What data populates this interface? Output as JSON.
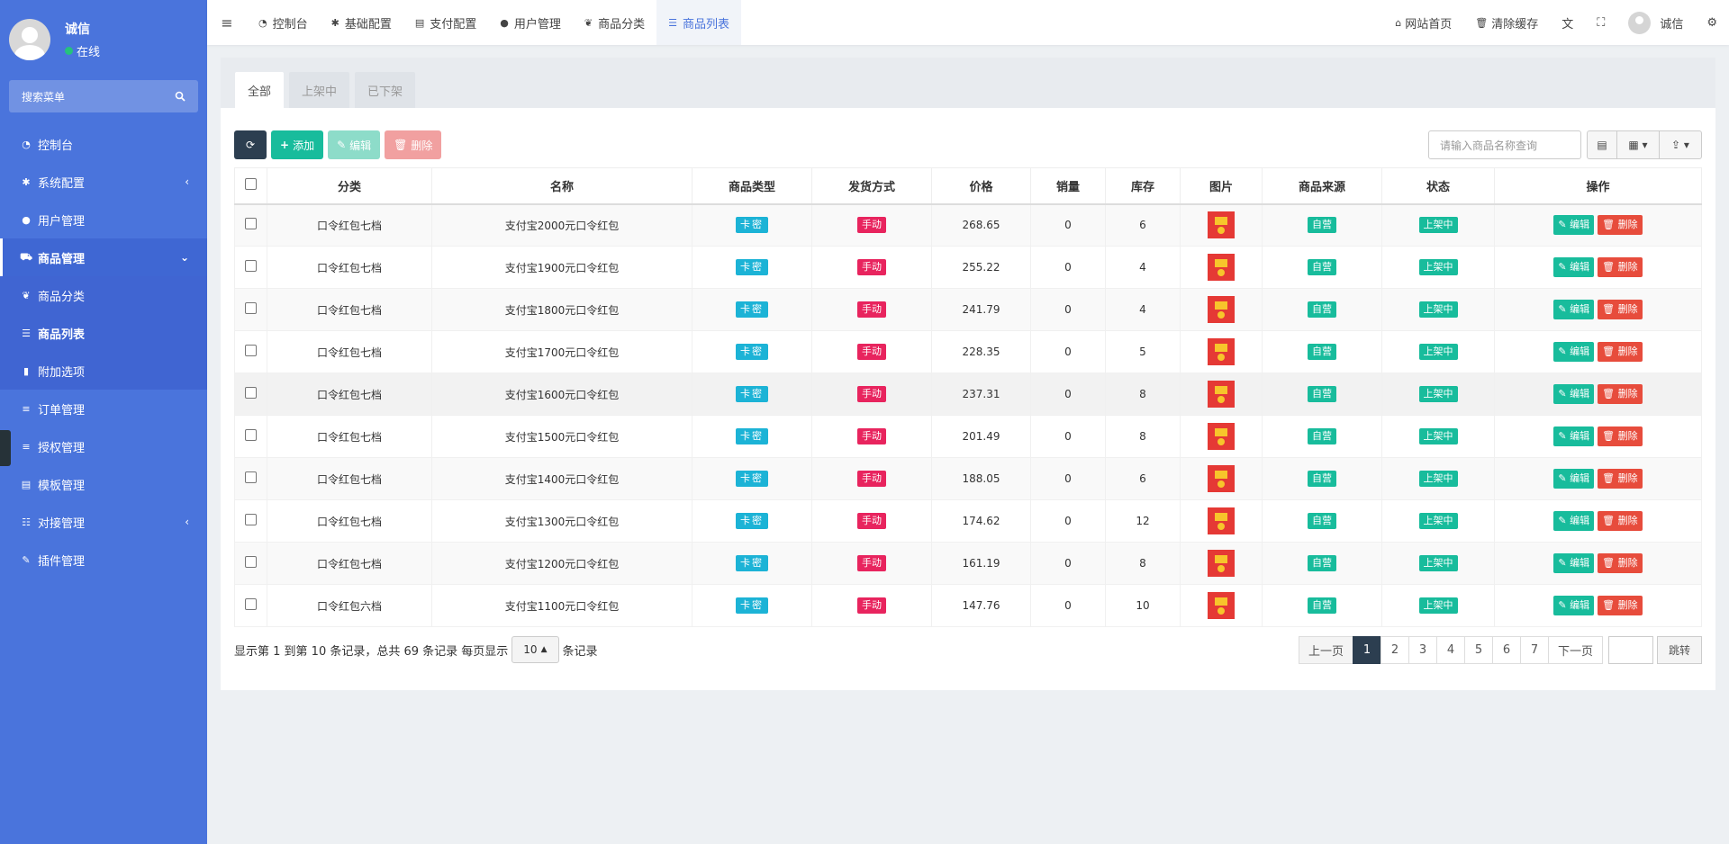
{
  "user": {
    "name": "诚信",
    "status": "在线"
  },
  "sidebar": {
    "search_placeholder": "搜索菜单",
    "items": [
      {
        "label": "控制台",
        "icon": "dashboard-icon"
      },
      {
        "label": "系统配置",
        "icon": "gear-icon"
      },
      {
        "label": "用户管理",
        "icon": "user-icon"
      },
      {
        "label": "商品管理",
        "icon": "cart-icon"
      },
      {
        "label": "商品分类",
        "icon": "leaf-icon"
      },
      {
        "label": "商品列表",
        "icon": "list-icon"
      },
      {
        "label": "附加选项",
        "icon": "bookmark-icon"
      },
      {
        "label": "订单管理",
        "icon": "bars-icon"
      },
      {
        "label": "授权管理",
        "icon": "bars-icon"
      },
      {
        "label": "模板管理",
        "icon": "table-icon"
      },
      {
        "label": "对接管理",
        "icon": "sliders-icon"
      },
      {
        "label": "插件管理",
        "icon": "plug-icon"
      }
    ]
  },
  "navbar": {
    "tabs": [
      "控制台",
      "基础配置",
      "支付配置",
      "用户管理",
      "商品分类",
      "商品列表"
    ],
    "home": "网站首页",
    "clear_cache": "清除缓存",
    "user": "诚信"
  },
  "tabs": [
    "全部",
    "上架中",
    "已下架"
  ],
  "toolbar": {
    "add": "添加",
    "edit": "编辑",
    "delete": "删除",
    "search_placeholder": "请输入商品名称查询"
  },
  "columns": [
    "分类",
    "名称",
    "商品类型",
    "发货方式",
    "价格",
    "销量",
    "库存",
    "图片",
    "商品来源",
    "状态",
    "操作"
  ],
  "rows": [
    {
      "category": "口令红包七档",
      "name": "支付宝2000元口令红包",
      "type": "卡密",
      "delivery": "手动",
      "price": "268.65",
      "sales": "0",
      "stock": "6",
      "source": "自营",
      "status": "上架中"
    },
    {
      "category": "口令红包七档",
      "name": "支付宝1900元口令红包",
      "type": "卡密",
      "delivery": "手动",
      "price": "255.22",
      "sales": "0",
      "stock": "4",
      "source": "自营",
      "status": "上架中"
    },
    {
      "category": "口令红包七档",
      "name": "支付宝1800元口令红包",
      "type": "卡密",
      "delivery": "手动",
      "price": "241.79",
      "sales": "0",
      "stock": "4",
      "source": "自营",
      "status": "上架中"
    },
    {
      "category": "口令红包七档",
      "name": "支付宝1700元口令红包",
      "type": "卡密",
      "delivery": "手动",
      "price": "228.35",
      "sales": "0",
      "stock": "5",
      "source": "自营",
      "status": "上架中"
    },
    {
      "category": "口令红包七档",
      "name": "支付宝1600元口令红包",
      "type": "卡密",
      "delivery": "手动",
      "price": "237.31",
      "sales": "0",
      "stock": "8",
      "source": "自营",
      "status": "上架中"
    },
    {
      "category": "口令红包七档",
      "name": "支付宝1500元口令红包",
      "type": "卡密",
      "delivery": "手动",
      "price": "201.49",
      "sales": "0",
      "stock": "8",
      "source": "自营",
      "status": "上架中"
    },
    {
      "category": "口令红包七档",
      "name": "支付宝1400元口令红包",
      "type": "卡密",
      "delivery": "手动",
      "price": "188.05",
      "sales": "0",
      "stock": "6",
      "source": "自营",
      "status": "上架中"
    },
    {
      "category": "口令红包七档",
      "name": "支付宝1300元口令红包",
      "type": "卡密",
      "delivery": "手动",
      "price": "174.62",
      "sales": "0",
      "stock": "12",
      "source": "自营",
      "status": "上架中"
    },
    {
      "category": "口令红包七档",
      "name": "支付宝1200元口令红包",
      "type": "卡密",
      "delivery": "手动",
      "price": "161.19",
      "sales": "0",
      "stock": "8",
      "source": "自营",
      "status": "上架中"
    },
    {
      "category": "口令红包六档",
      "name": "支付宝1100元口令红包",
      "type": "卡密",
      "delivery": "手动",
      "price": "147.76",
      "sales": "0",
      "stock": "10",
      "source": "自营",
      "status": "上架中"
    }
  ],
  "row_actions": {
    "edit": "编辑",
    "delete": "删除"
  },
  "pagination": {
    "info_a": "显示第 1 到第 10 条记录，总共 69 条记录 每页显示",
    "page_size": "10",
    "info_b": "条记录",
    "prev": "上一页",
    "pages": [
      "1",
      "2",
      "3",
      "4",
      "5",
      "6",
      "7"
    ],
    "next": "下一页",
    "jump": "跳转"
  },
  "colors": {
    "sidebar": "#4a74dc",
    "green": "#18bc9c",
    "cyan": "#1cb3d6",
    "pink": "#e8245e",
    "red": "#e74c3c",
    "dark": "#2c3e50"
  }
}
